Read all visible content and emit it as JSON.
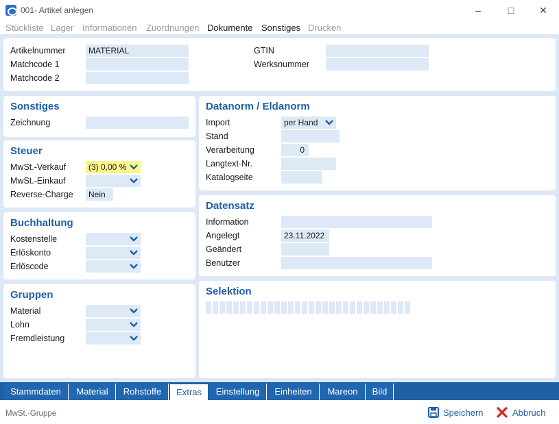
{
  "window": {
    "title": "001- Artikel anlegen"
  },
  "menu": [
    "Stückliste",
    "Lager",
    "Informationen",
    "Zuordnungen",
    "Dokumente",
    "Sonstiges",
    "Drucken"
  ],
  "header": {
    "artikelnummer_label": "Artikelnummer",
    "artikelnummer_value": "MATERIAL",
    "matchcode1_label": "Matchcode 1",
    "matchcode2_label": "Matchcode 2",
    "gtin_label": "GTIN",
    "werksnummer_label": "Werksnummer"
  },
  "sonstiges": {
    "title": "Sonstiges",
    "zeichnung_label": "Zeichnung"
  },
  "steuer": {
    "title": "Steuer",
    "mwst_verkauf_label": "MwSt.-Verkauf",
    "mwst_verkauf_value": "(3) 0,00 %",
    "mwst_einkauf_label": "MwSt.-Einkauf",
    "reverse_charge_label": "Reverse-Charge",
    "reverse_charge_value": "Nein"
  },
  "buchhaltung": {
    "title": "Buchhaltung",
    "kostenstelle_label": "Kostenstelle",
    "erloeskonto_label": "Erlöskonto",
    "erloescode_label": "Erlöscode"
  },
  "gruppen": {
    "title": "Gruppen",
    "material_label": "Material",
    "lohn_label": "Lohn",
    "fremdleistung_label": "Fremdleistung"
  },
  "datanorm": {
    "title": "Datanorm / Eldanorm",
    "import_label": "Import",
    "import_value": "per Hand",
    "stand_label": "Stand",
    "verarbeitung_label": "Verarbeitung",
    "verarbeitung_value": "0",
    "langtext_label": "Langtext-Nr.",
    "katalogseite_label": "Katalogseite"
  },
  "datensatz": {
    "title": "Datensatz",
    "information_label": "Information",
    "angelegt_label": "Angelegt",
    "angelegt_value": "23.11.2022",
    "geaendert_label": "Geändert",
    "benutzer_label": "Benutzer"
  },
  "selektion": {
    "title": "Selektion"
  },
  "tabs": [
    "Stammdaten",
    "Material",
    "Rohstoffe",
    "Extras",
    "Einstellung",
    "Einheiten",
    "Mareon",
    "Bild"
  ],
  "active_tab": "Extras",
  "status": {
    "text": "MwSt.-Gruppe",
    "save_label": "Speichern",
    "cancel_label": "Abbruch"
  },
  "colors": {
    "accent": "#1f5fa6",
    "field": "#dde9f6",
    "highlight": "#fbf58c",
    "background": "#dce8f5",
    "cancel": "#d9261c"
  }
}
